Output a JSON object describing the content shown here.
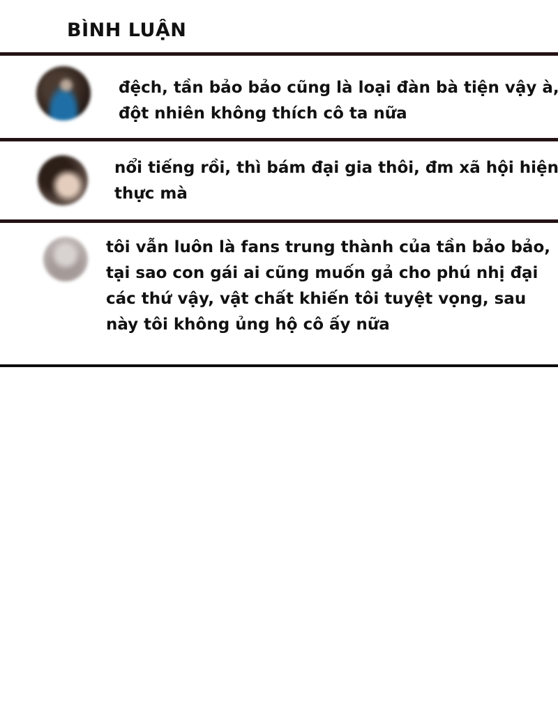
{
  "header": {
    "title": "BÌNH LUẬN"
  },
  "comments": [
    {
      "avatar_icon": "user-avatar-icon",
      "lines": [
        "đệch, tần bảo bảo cũng là loại đàn bà tiện vậy à,",
        "đột nhiên không thích cô ta nữa"
      ]
    },
    {
      "avatar_icon": "user-avatar-icon",
      "lines": [
        "nổi tiếng rồi, thì bám đại gia thôi, đm xã hội hiện",
        "thực mà"
      ]
    },
    {
      "avatar_icon": "user-avatar-icon",
      "lines": [
        "tôi vẫn luôn là fans trung thành của tần bảo bảo,",
        "tại sao con gái ai cũng muốn gả cho phú nhị đại",
        "các thứ vậy, vật chất khiến tôi tuyệt vọng, sau",
        "này tôi không ủng hộ cô ấy nữa"
      ]
    }
  ],
  "colors": {
    "divider": "#241315",
    "text": "#111111",
    "background": "#ffffff"
  }
}
